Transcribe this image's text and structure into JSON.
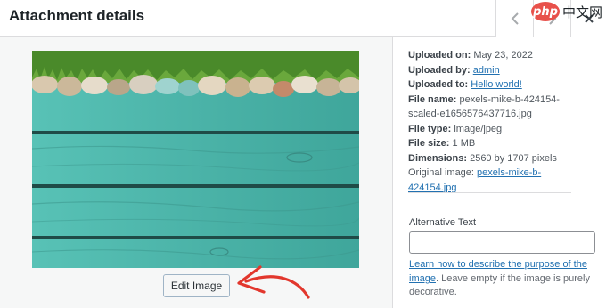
{
  "header": {
    "title": "Attachment details",
    "prev_icon": "chevron-left-icon",
    "next_icon": "chevron-right-icon",
    "close_icon": "close-icon"
  },
  "watermark": {
    "logo": "php",
    "text": "中文网"
  },
  "left": {
    "edit_button_label": "Edit Image",
    "image_icon": "attachment-image-teal-wood-pebbles-grass"
  },
  "details": {
    "uploaded_on_label": "Uploaded on:",
    "uploaded_on_value": "May 23, 2022",
    "uploaded_by_label": "Uploaded by:",
    "uploaded_by_value": "admin",
    "uploaded_to_label": "Uploaded to:",
    "uploaded_to_value": "Hello world!",
    "file_name_label": "File name:",
    "file_name_line1": "pexels-mike-b-424154-",
    "file_name_line2": "scaled-e1656576437716.jpg",
    "file_type_label": "File type:",
    "file_type_value": "image/jpeg",
    "file_size_label": "File size:",
    "file_size_value": "1 MB",
    "dimensions_label": "Dimensions:",
    "dimensions_value": "2560 by 1707 pixels",
    "original_label": "Original image:",
    "original_line1": "pexels-mike-b-",
    "original_line2": "424154.jpg"
  },
  "alt": {
    "label": "Alternative Text",
    "value": "",
    "help_link": "Learn how to describe the purpose of the image",
    "help_rest": ". Leave empty if the image is purely decorative."
  },
  "colors": {
    "link": "#2271b1",
    "annotation_arrow": "#e2372d",
    "wood": "#4fb8ad",
    "grass": "#4a8a2a"
  }
}
